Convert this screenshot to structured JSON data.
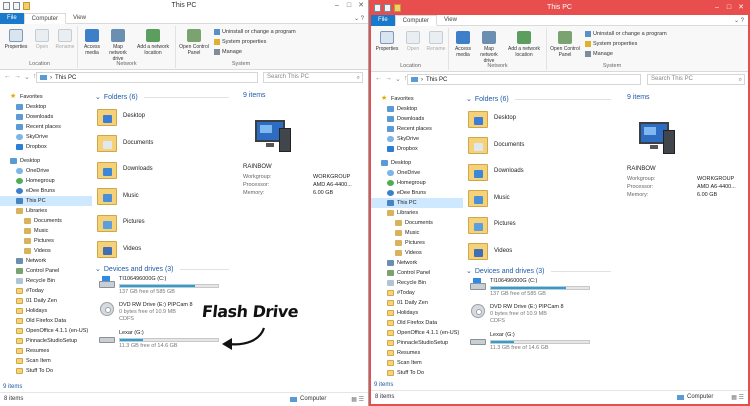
{
  "colors": {
    "accent": "#1979ca",
    "highlight_border": "#e84e4e",
    "storage_bar": "#26a0da",
    "selected": "#cde8ff",
    "section_header": "#1e5aa8"
  },
  "window": {
    "title": "This PC",
    "tabs": [
      "File",
      "Computer",
      "View"
    ],
    "ribbon": {
      "location": {
        "label": "Location",
        "properties": "Properties",
        "open": "Open",
        "rename": "Rename"
      },
      "network": {
        "label": "Network",
        "access_media": "Access media",
        "map_network_drive": "Map network drive",
        "add_network_location": "Add a network location"
      },
      "system": {
        "label": "System",
        "open_control_panel": "Open Control Panel",
        "uninstall": "Uninstall or change a program",
        "system_properties": "System properties",
        "manage": "Manage"
      }
    },
    "address": {
      "path": "This PC",
      "search_placeholder": "Search This PC"
    },
    "nav": {
      "favorites": "Favorites",
      "favorites_items": [
        "Desktop",
        "Downloads",
        "Recent places",
        "SkyDrive",
        "Dropbox"
      ],
      "desktop": "Desktop",
      "desktop_items": [
        "OneDrive",
        "Homegroup",
        "eDee Bruns",
        "This PC",
        "Libraries"
      ],
      "libraries": [
        "Documents",
        "Music",
        "Pictures",
        "Videos"
      ],
      "other": [
        "Network",
        "Control Panel",
        "Recycle Bin"
      ],
      "folders": [
        "#Today",
        "01 Daily Zen",
        "Holidays",
        "Old Firefox Data",
        "OpenOffice 4.1.1 (en-US)",
        "PinnacleStudioSetup",
        "Resumes",
        "Scan Item",
        "Stuff To Do"
      ],
      "status_left": "9 items"
    },
    "folders_header": "Folders (6)",
    "folders": [
      "Desktop",
      "Documents",
      "Downloads",
      "Music",
      "Pictures",
      "Videos"
    ],
    "devices_header": "Devices and drives (3)",
    "drives": [
      {
        "name": "TI106496000G (C:)",
        "free": "137 GB free of 585 GB",
        "usage": 0.77,
        "icon": "windows-drive-icon"
      },
      {
        "name": "DVD RW Drive (E:) PIPCam 8",
        "free": "0 bytes free of 10.9 MB",
        "extra": "CDFS",
        "usage": 1.0,
        "icon": "dvd-drive-icon"
      },
      {
        "name": "Lexar (G:)",
        "free": "11.3 GB free of 14.6 GB",
        "usage": 0.23,
        "icon": "flash-drive-icon"
      }
    ],
    "details": {
      "count": "9 items",
      "pc_name": "RAINBOW",
      "workgroup_label": "Workgroup:",
      "workgroup": "WORKGROUP",
      "processor_label": "Processor:",
      "processor": "AMD A6-4400...",
      "memory_label": "Memory:",
      "memory": "6.00 GB"
    },
    "status": {
      "items": "8 items",
      "location": "Computer"
    }
  },
  "annotation": {
    "text": "Flash Drive"
  }
}
